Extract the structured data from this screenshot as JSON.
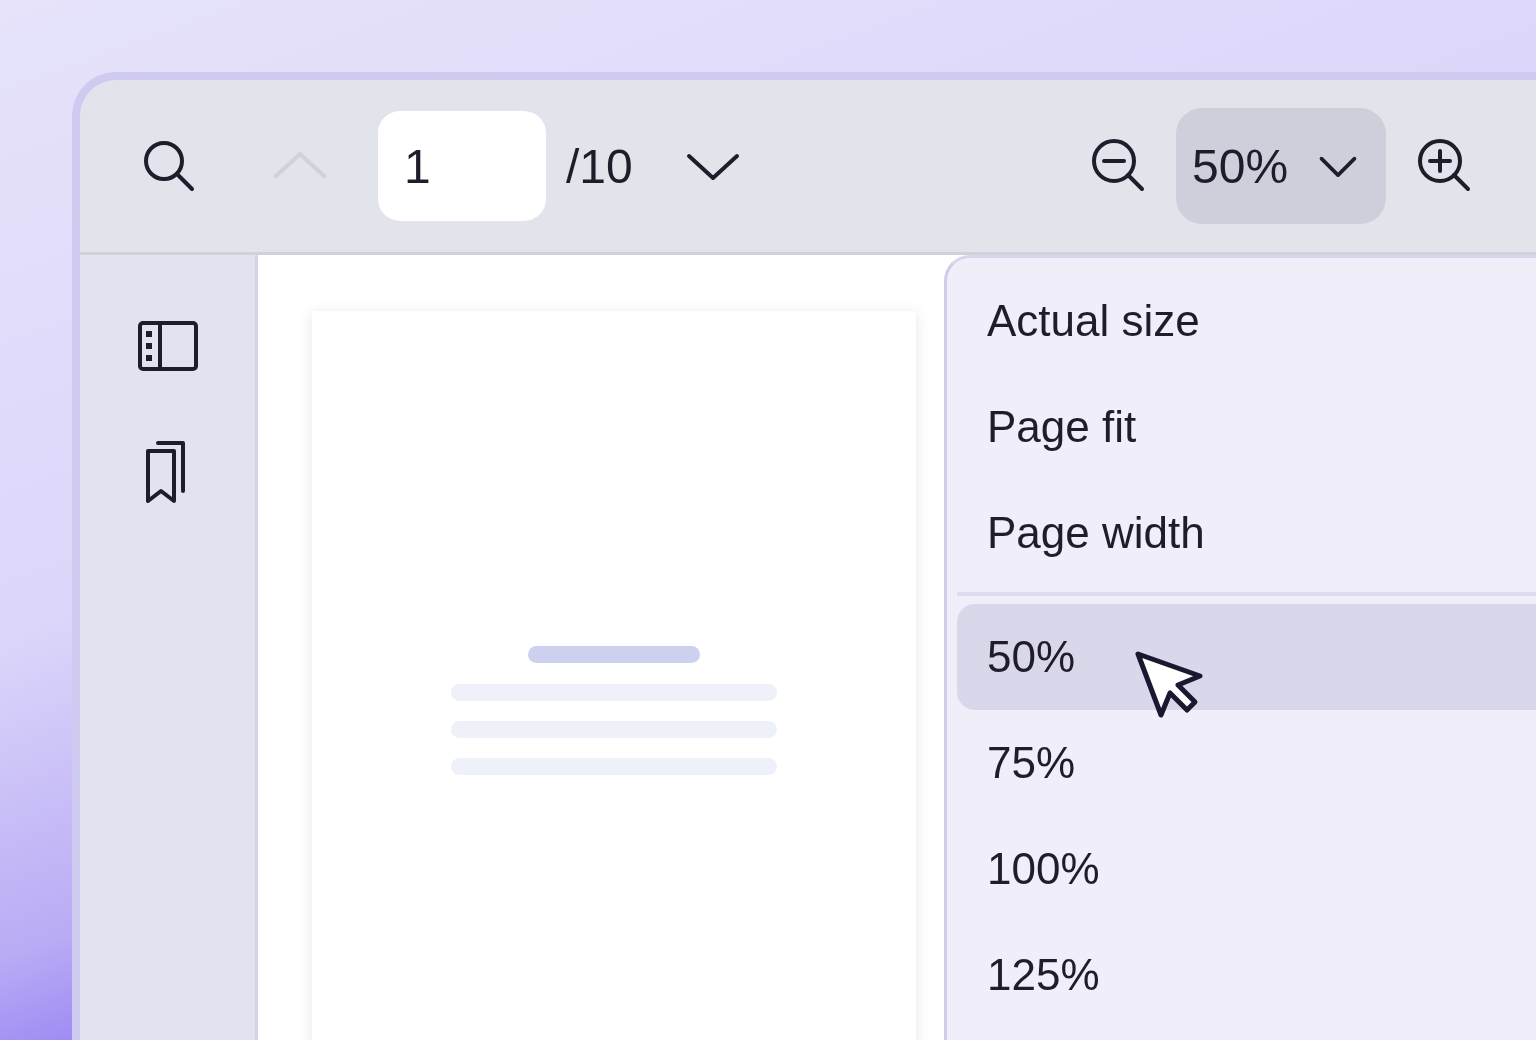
{
  "toolbar": {
    "previous_page": {
      "disabled": true
    },
    "page_field": {
      "value": "1"
    },
    "page_total": "/10",
    "zoom": {
      "value": "50%",
      "open": true
    }
  },
  "zoom_menu": {
    "sections": [
      {
        "items": [
          {
            "label": "Actual size",
            "selected": false
          },
          {
            "label": "Page fit",
            "selected": false
          },
          {
            "label": "Page width",
            "selected": false
          }
        ]
      },
      {
        "items": [
          {
            "label": "50%",
            "selected": true
          },
          {
            "label": "75%",
            "selected": false
          },
          {
            "label": "100%",
            "selected": false
          },
          {
            "label": "125%",
            "selected": false
          }
        ]
      }
    ]
  }
}
